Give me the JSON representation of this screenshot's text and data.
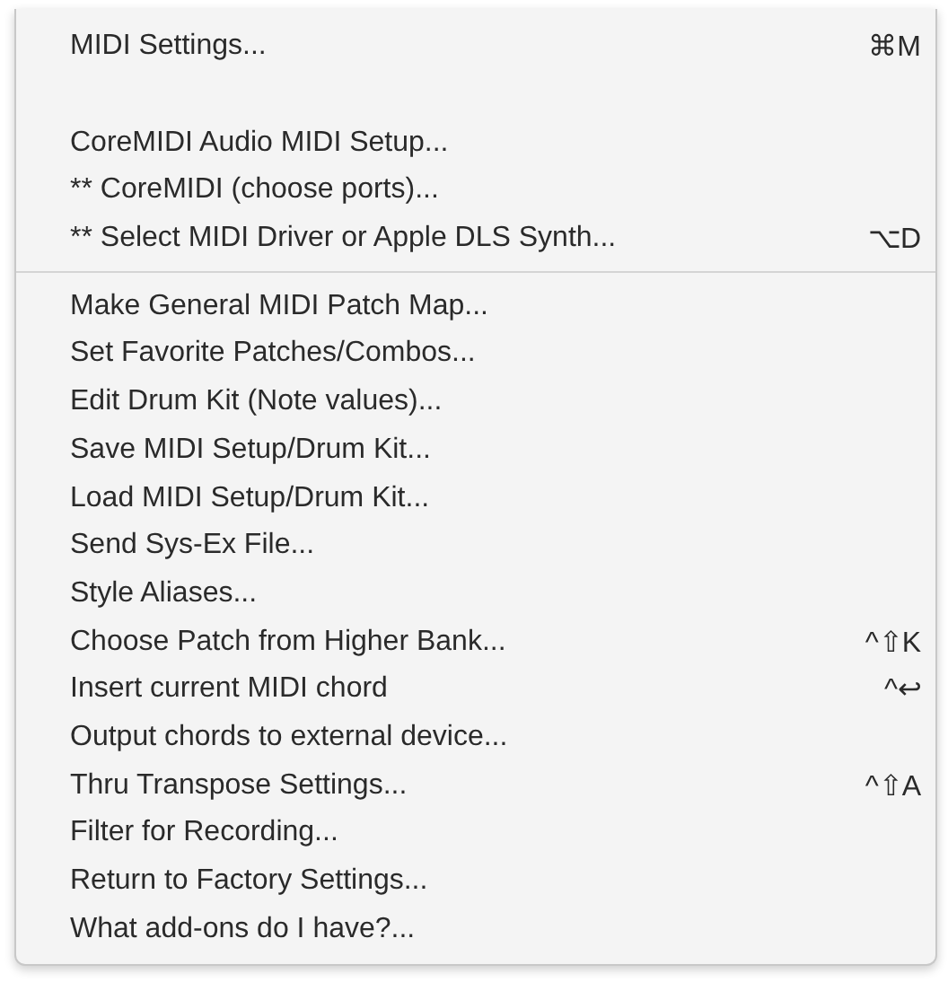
{
  "menu": {
    "items": [
      {
        "kind": "item",
        "label": "MIDI Settings...",
        "shortcut": "⌘M"
      },
      {
        "kind": "spacer"
      },
      {
        "kind": "item",
        "label": "CoreMIDI Audio MIDI Setup..."
      },
      {
        "kind": "item",
        "label": "** CoreMIDI (choose ports)..."
      },
      {
        "kind": "item",
        "label": "** Select MIDI Driver or Apple DLS Synth...",
        "shortcut": "⌥D"
      },
      {
        "kind": "separator"
      },
      {
        "kind": "item",
        "label": "Make General MIDI Patch Map..."
      },
      {
        "kind": "item",
        "label": "Set Favorite Patches/Combos..."
      },
      {
        "kind": "item",
        "label": "Edit Drum Kit (Note values)..."
      },
      {
        "kind": "item",
        "label": "Save MIDI Setup/Drum Kit..."
      },
      {
        "kind": "item",
        "label": "Load MIDI Setup/Drum Kit..."
      },
      {
        "kind": "item",
        "label": "Send Sys-Ex File..."
      },
      {
        "kind": "item",
        "label": "Style Aliases..."
      },
      {
        "kind": "item",
        "label": "Choose Patch from Higher Bank...",
        "shortcut": "^⇧K"
      },
      {
        "kind": "item",
        "label": "Insert current MIDI chord",
        "shortcut": "^↩"
      },
      {
        "kind": "item",
        "label": "Output chords to external device..."
      },
      {
        "kind": "item",
        "label": "Thru Transpose Settings...",
        "shortcut": "^⇧A"
      },
      {
        "kind": "item",
        "label": "Filter for Recording..."
      },
      {
        "kind": "item",
        "label": "Return to Factory Settings..."
      },
      {
        "kind": "item",
        "label": "What add-ons do I have?..."
      }
    ]
  }
}
